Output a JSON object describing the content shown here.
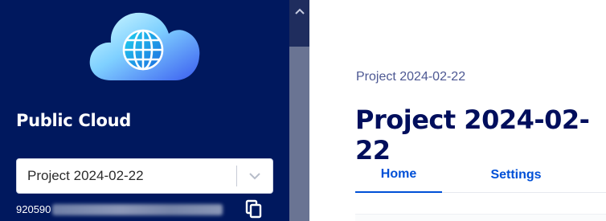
{
  "sidebar": {
    "logo_icon": "cloud-globe-icon",
    "product_title": "Public Cloud",
    "project_select": {
      "selected_value": "Project 2024-02-22",
      "chevron_icon": "chevron-down-icon"
    },
    "project_id_prefix": "920590",
    "copy_icon": "copy-icon"
  },
  "main": {
    "breadcrumb": "Project 2024-02-22",
    "title": "Project 2024-02-22",
    "tabs": [
      {
        "label": "Home",
        "active": true
      },
      {
        "label": "Settings",
        "active": false
      }
    ]
  },
  "colors": {
    "sidebar_bg": "#00185e",
    "title_color": "#000e5c",
    "accent": "#0050d7"
  }
}
